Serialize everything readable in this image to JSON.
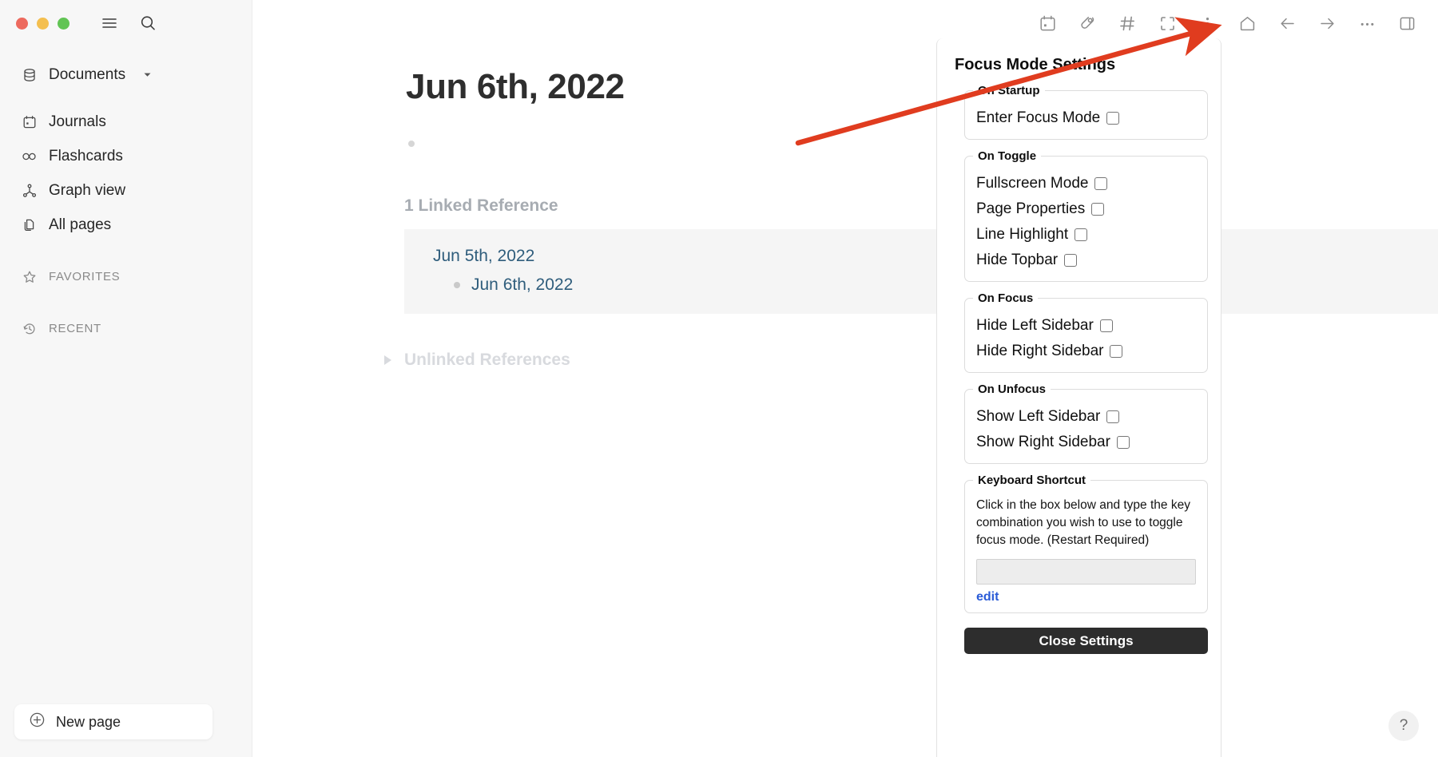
{
  "window": {
    "traffic_lights": [
      "close",
      "minimize",
      "maximize"
    ],
    "colors": {
      "close": "#ed6a5e",
      "minimize": "#f4bf4f",
      "maximize": "#61c454",
      "accent_link": "#2f5d7c",
      "annotation_arrow": "#e03c1f",
      "button_dark": "#2d2d2d",
      "edit_link": "#2a5bd7"
    }
  },
  "sidebar": {
    "hamburger_icon": "menu-icon",
    "search_icon": "search-icon",
    "graph": {
      "icon": "database-icon",
      "label": "Documents",
      "caret": "chevron-down-icon"
    },
    "items": [
      {
        "icon": "calendar-icon",
        "label": "Journals"
      },
      {
        "icon": "infinity-icon",
        "label": "Flashcards"
      },
      {
        "icon": "graph-icon",
        "label": "Graph view"
      },
      {
        "icon": "pages-icon",
        "label": "All pages"
      }
    ],
    "sections": [
      {
        "icon": "star-icon",
        "label": "FAVORITES"
      },
      {
        "icon": "clock-icon",
        "label": "RECENT"
      }
    ],
    "new_page": {
      "icon": "plus-circle-icon",
      "label": "New page"
    }
  },
  "topbar": {
    "icons": [
      {
        "name": "calendar-icon",
        "title": "Journals"
      },
      {
        "name": "pen-icon",
        "title": "Annotate"
      },
      {
        "name": "hash-icon",
        "title": "Tags"
      },
      {
        "name": "focus-brackets-icon",
        "title": "Focus Mode"
      },
      {
        "name": "vertical-dots-icon",
        "title": "Focus Mode Settings"
      },
      {
        "name": "home-icon",
        "title": "Home"
      },
      {
        "name": "arrow-left-icon",
        "title": "Back"
      },
      {
        "name": "arrow-right-icon",
        "title": "Forward"
      },
      {
        "name": "ellipsis-icon",
        "title": "More"
      },
      {
        "name": "right-sidebar-icon",
        "title": "Toggle right sidebar"
      }
    ]
  },
  "main": {
    "page_title": "Jun 6th, 2022",
    "empty_bullet": "",
    "linked_references_heading": "1 Linked Reference",
    "reference": {
      "parent": "Jun 5th, 2022",
      "child": "Jun 6th, 2022"
    },
    "unlinked_references_heading": "Unlinked References",
    "help_label": "?"
  },
  "settings_panel": {
    "title": "Focus Mode Settings",
    "groups": [
      {
        "legend": "On Startup",
        "options": [
          {
            "label": "Enter Focus Mode",
            "checked": false
          }
        ]
      },
      {
        "legend": "On Toggle",
        "options": [
          {
            "label": "Fullscreen Mode",
            "checked": false
          },
          {
            "label": "Page Properties",
            "checked": false
          },
          {
            "label": "Line Highlight",
            "checked": false
          },
          {
            "label": "Hide Topbar",
            "checked": false
          }
        ]
      },
      {
        "legend": "On Focus",
        "options": [
          {
            "label": "Hide Left Sidebar",
            "checked": false
          },
          {
            "label": "Hide Right Sidebar",
            "checked": false
          }
        ]
      },
      {
        "legend": "On Unfocus",
        "options": [
          {
            "label": "Show Left Sidebar",
            "checked": false
          },
          {
            "label": "Show Right Sidebar",
            "checked": false
          }
        ]
      }
    ],
    "keyboard_shortcut": {
      "legend": "Keyboard Shortcut",
      "description": "Click in the box below and type the key combination you wish to use to toggle focus mode. (Restart Required)",
      "input_value": "",
      "edit_label": "edit"
    },
    "close_label": "Close Settings"
  }
}
